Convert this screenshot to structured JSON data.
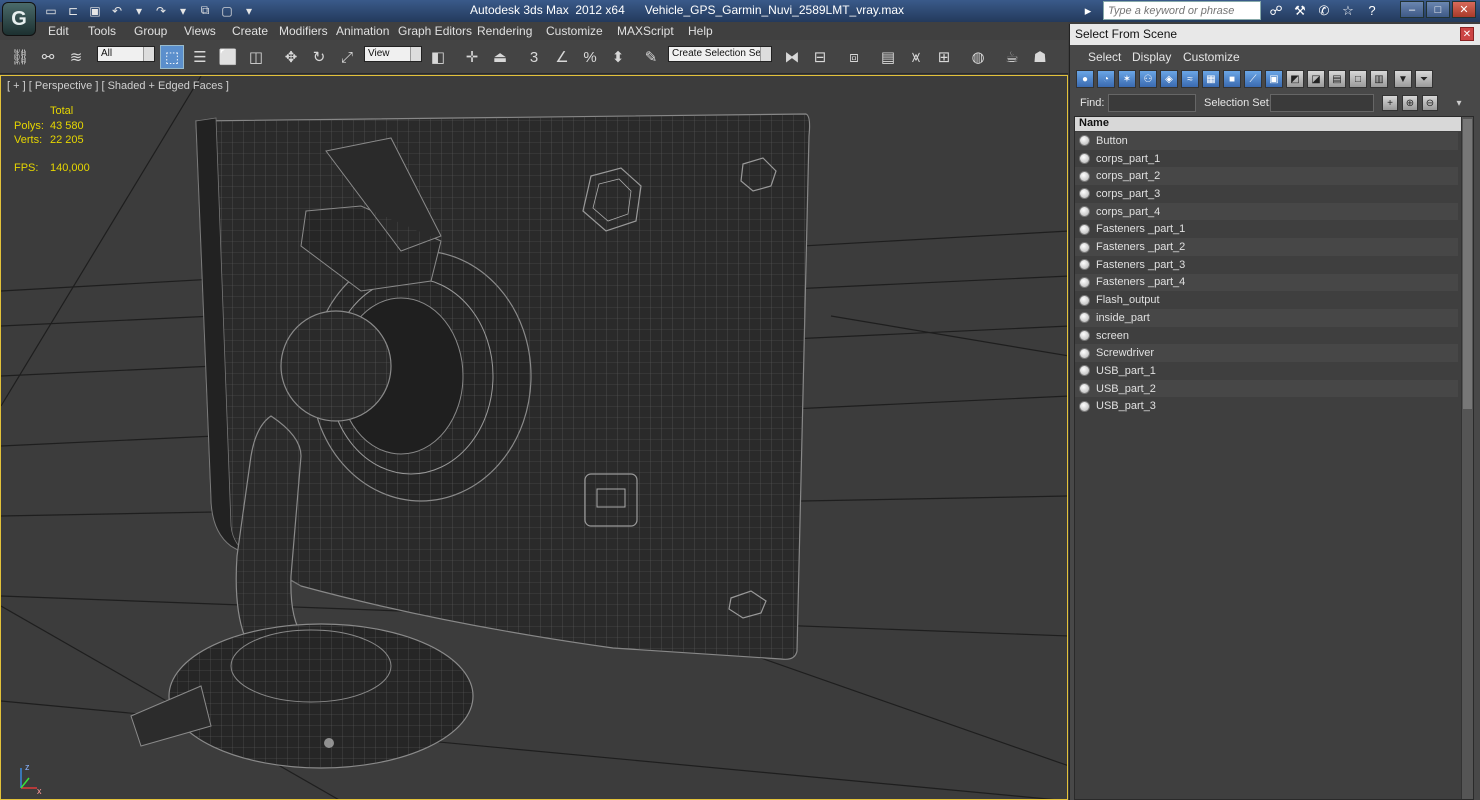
{
  "window": {
    "app_name": "Autodesk 3ds Max  2012 x64",
    "file_name": "Vehicle_GPS_Garmin_Nuvi_2589LMT_vray.max",
    "keyword_placeholder": "Type a keyword or phrase"
  },
  "menu": [
    "Edit",
    "Tools",
    "Group",
    "Views",
    "Create",
    "Modifiers",
    "Animation",
    "Graph Editors",
    "Rendering",
    "Customize",
    "MAXScript",
    "Help"
  ],
  "toolbar": {
    "filter_value": "All",
    "coord_value": "View",
    "selection_set_placeholder": "Create Selection Se"
  },
  "viewport": {
    "label": "[ + ] [ Perspective ] [ Shaded + Edged Faces ]",
    "stats": {
      "total_label": "Total",
      "polys_label": "Polys:",
      "polys_value": "43 580",
      "verts_label": "Verts:",
      "verts_value": "22 205",
      "fps_label": "FPS:",
      "fps_value": "140,000"
    },
    "axis_labels": {
      "z": "z",
      "x": "x"
    }
  },
  "dialog": {
    "title": "Select From Scene",
    "menu": [
      "Select",
      "Display",
      "Customize"
    ],
    "find_label": "Find:",
    "selection_set_label": "Selection Set:",
    "column_name": "Name",
    "objects": [
      "Button",
      "corps_part_1",
      "corps_part_2",
      "corps_part_3",
      "corps_part_4",
      "Fasteners _part_1",
      "Fasteners _part_2",
      "Fasteners _part_3",
      "Fasteners _part_4",
      "Flash_output",
      "inside_part",
      "screen",
      "Screwdriver",
      "USB_part_1",
      "USB_part_2",
      "USB_part_3"
    ]
  },
  "colors": {
    "stats_text": "#e6d600",
    "viewport_bg": "#3c3c3c",
    "title_bar": "#2e4a74",
    "active_tool": "#5b8fcc"
  }
}
